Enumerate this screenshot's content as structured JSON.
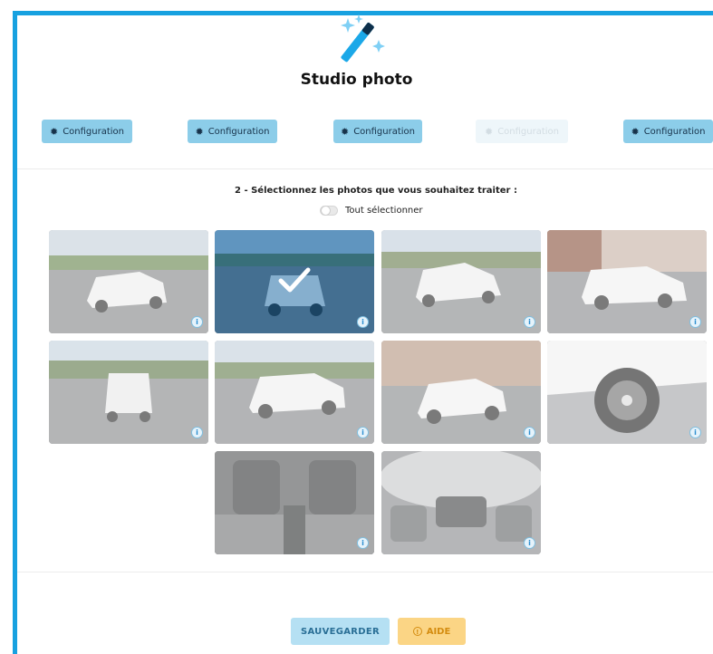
{
  "header": {
    "title": "Studio photo",
    "logo_icon": "magic-wand-icon"
  },
  "config_buttons": [
    {
      "label": "Configuration",
      "enabled": true
    },
    {
      "label": "Configuration",
      "enabled": true
    },
    {
      "label": "Configuration",
      "enabled": true
    },
    {
      "label": "Configuration",
      "enabled": false
    },
    {
      "label": "Configuration",
      "enabled": true
    }
  ],
  "selection": {
    "instruction": "2 - Sélectionnez les photos que vous souhaitez traiter :",
    "select_all_label": "Tout sélectionner",
    "select_all_on": false
  },
  "photos": [
    {
      "view": "front-three-quarter-left",
      "selected": false
    },
    {
      "view": "front",
      "selected": true
    },
    {
      "view": "front-three-quarter-right",
      "selected": false
    },
    {
      "view": "side-right",
      "selected": false
    },
    {
      "view": "rear",
      "selected": false
    },
    {
      "view": "rear-three-quarter-left",
      "selected": false
    },
    {
      "view": "three-quarter-building",
      "selected": false
    },
    {
      "view": "wheel-closeup",
      "selected": false
    },
    {
      "view": "interior-rear",
      "selected": false
    },
    {
      "view": "interior-360",
      "selected": false
    }
  ],
  "actions": {
    "save_label": "SAUVEGARDER",
    "help_label": "AIDE",
    "help_icon": "info-circle-icon"
  },
  "colors": {
    "accent": "#17a1e0",
    "config_bg": "#8ccde9",
    "save_bg": "#b5e0f3",
    "help_bg": "#fbd585"
  }
}
